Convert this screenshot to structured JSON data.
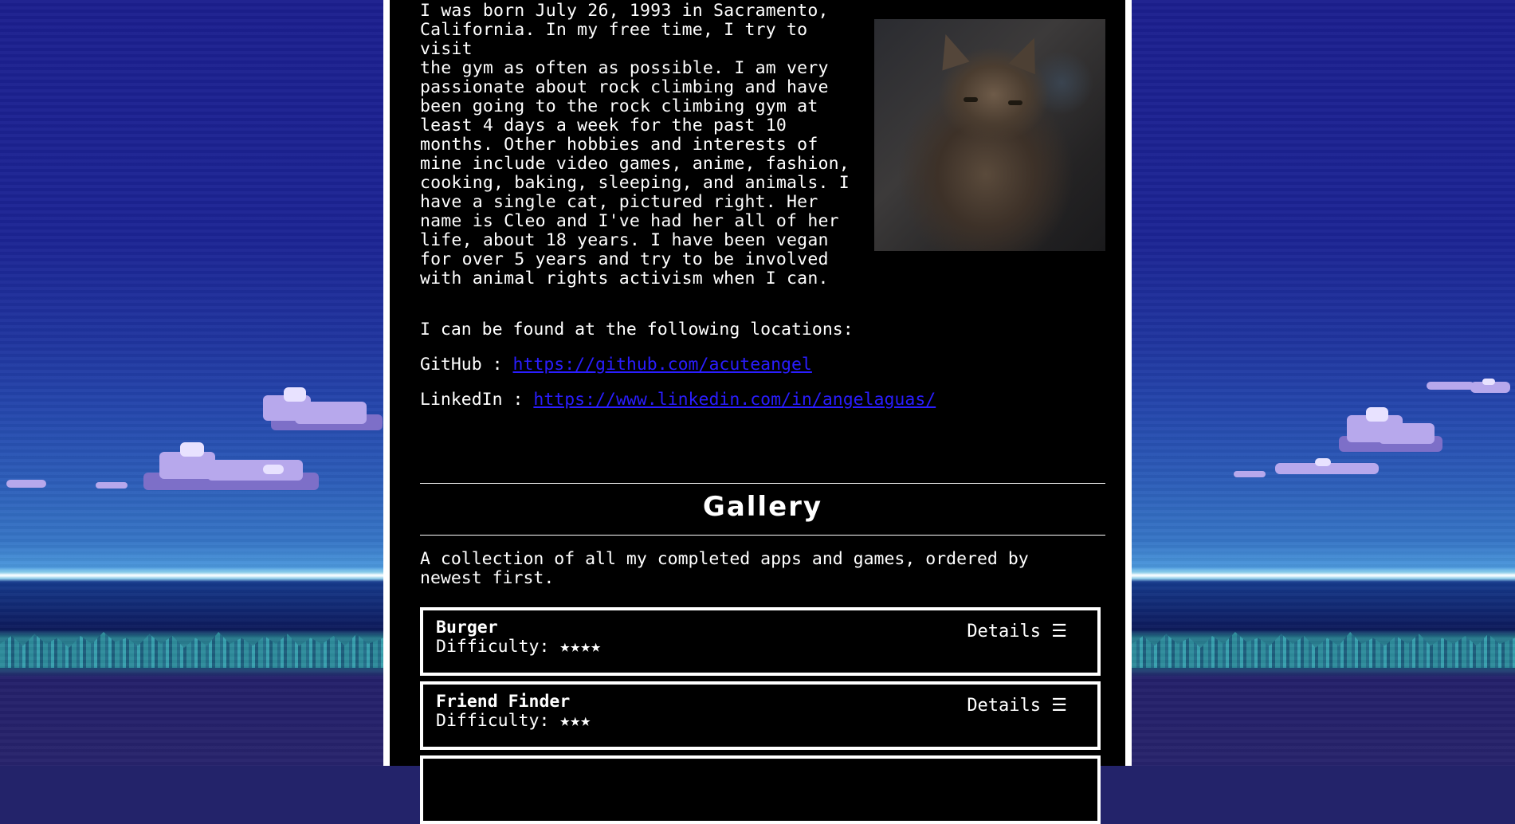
{
  "bio": {
    "text": "I was born July 26, 1993 in Sacramento,\nCalifornia. In my free time, I try to visit\nthe gym as often as possible. I am very\npassionate about rock climbing and have\nbeen going to the rock climbing gym at\nleast 4 days a week for the past 10\nmonths. Other hobbies and interests of\nmine include video games, anime, fashion,\ncooking, baking, sleeping, and animals. I\nhave a single cat, pictured right. Her\nname is Cleo and I've had her all of her\nlife, about 18 years. I have been vegan\nfor over 5 years and try to be involved\nwith animal rights activism when I can."
  },
  "locations": {
    "intro": "I can be found at the following locations:",
    "github": {
      "label": "GitHub : ",
      "url": "https://github.com/acuteangel"
    },
    "linkedin": {
      "label": "LinkedIn : ",
      "url": "https://www.linkedin.com/in/angelaguas/"
    }
  },
  "gallery": {
    "title": "Gallery",
    "description": "A collection of all my completed apps and games, ordered by\nnewest first.",
    "items": [
      {
        "title": "Burger",
        "difficulty": "Difficulty: ★★★★",
        "details": "Details ☰"
      },
      {
        "title": "Friend Finder",
        "difficulty": "Difficulty: ★★★",
        "details": "Details ☰"
      }
    ]
  },
  "colors": {
    "panel_bg": "#000000",
    "panel_border": "#ffffff",
    "link": "#2a1dff",
    "text": "#ffffff"
  }
}
